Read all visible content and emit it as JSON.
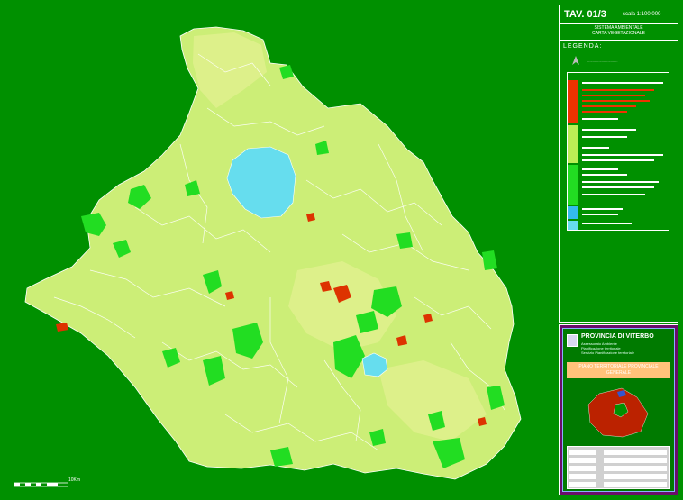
{
  "map": {
    "panel_title": "TAV. 01/3",
    "scale_text": "scala 1:100.000",
    "subtitle_1": "SISTEMA AMBIENTALE",
    "subtitle_2": "CARTA VEGETAZIONALE",
    "legend_heading": "LEGENDA:",
    "province": "PROVINCIA DI VITERBO",
    "assessorato_1": "Assessorato Ambiente",
    "assessorato_2": "Pianificazione territoriale",
    "assessorato_3": "Servizio Pianificazione territoriale",
    "plan_title_1": "PIANO TERRITORIALE PROVINCIALE",
    "plan_title_2": "GENERALE",
    "scale_bar_label": "10Km"
  },
  "colors": {
    "background": "#009000",
    "land_light": "#ccee77",
    "land_pale": "#ddf08a",
    "forest": "#22dd22",
    "lake": "#66ddee",
    "urban_red": "#dd3300",
    "legend_red": "#ee3300",
    "legend_lime": "#bbee55",
    "legend_green": "#22dd22",
    "legend_blue": "#33bbee",
    "legend_cyan": "#66ddee"
  }
}
